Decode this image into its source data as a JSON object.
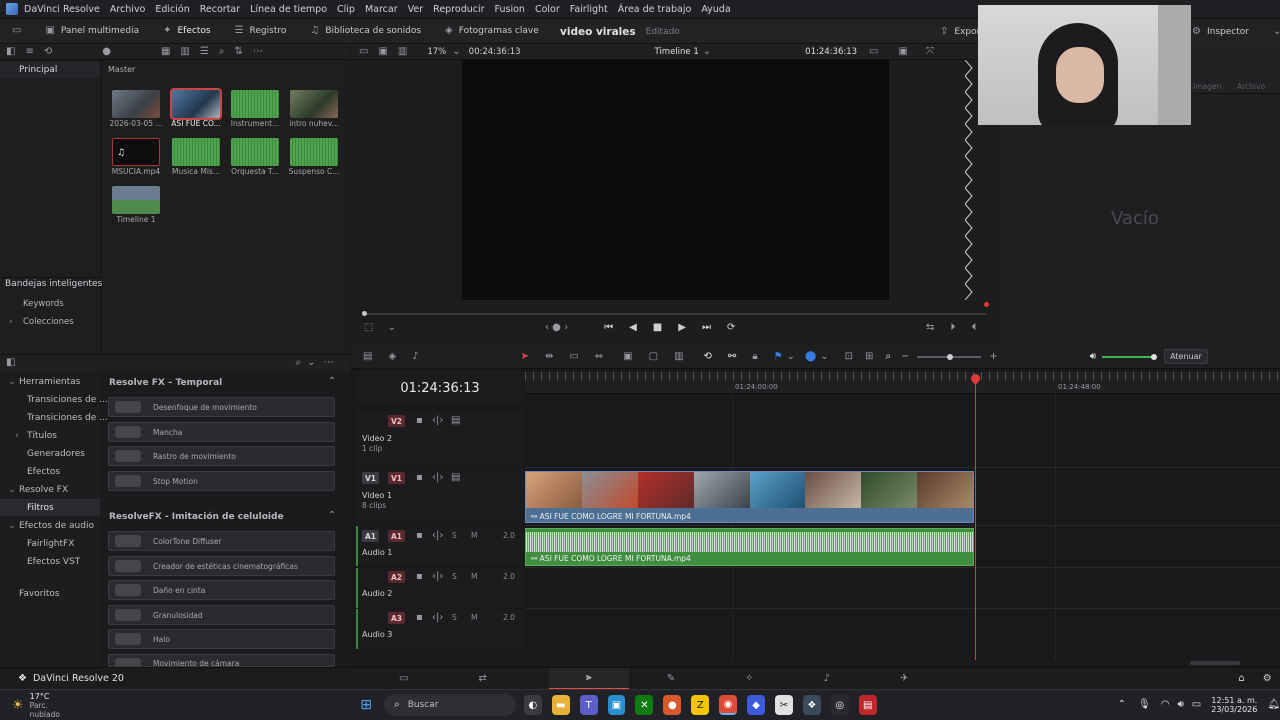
{
  "app": {
    "name": "DaVinci Resolve"
  },
  "menu": [
    "DaVinci Resolve",
    "Archivo",
    "Edición",
    "Recortar",
    "Línea de tiempo",
    "Clip",
    "Marcar",
    "Ver",
    "Reproducir",
    "Fusion",
    "Color",
    "Fairlight",
    "Área de trabajo",
    "Ayuda"
  ],
  "toolbar": {
    "media_pool": "Panel multimedia",
    "effects": "Efectos",
    "edit_index": "Registro",
    "sound_library": "Biblioteca de sonidos",
    "keyframes": "Fotogramas clave",
    "export": "Exporta",
    "inspector": "Inspector"
  },
  "project": {
    "title": "video virales",
    "state": "Editado"
  },
  "viewer": {
    "zoom": "17%",
    "source_tc": "00:24:36:13",
    "timeline_name": "Timeline 1",
    "record_tc": "01:24:36:13"
  },
  "media_pool": {
    "bin_principal": "Principal",
    "bin_master": "Master",
    "smart_bins": "Bandejas inteligentes",
    "smart_items": [
      "Keywords",
      "Colecciones"
    ],
    "clips": [
      {
        "label": "2026-03-05 ...",
        "kind": "video"
      },
      {
        "label": "ASI FUE CO...",
        "kind": "video"
      },
      {
        "label": "Instrument...",
        "kind": "audio"
      },
      {
        "label": "intro nuhev...",
        "kind": "video"
      },
      {
        "label": "MSUCIA.mp4",
        "kind": "audio-dark"
      },
      {
        "label": "Musica Mis...",
        "kind": "audio"
      },
      {
        "label": "Orquesta T...",
        "kind": "audio"
      },
      {
        "label": "Suspenso C...",
        "kind": "audio"
      },
      {
        "label": "Timeline 1",
        "kind": "timeline"
      }
    ]
  },
  "inspector": {
    "empty": "Vacío",
    "tab_image": "Imagen",
    "tab_file": "Archivo"
  },
  "fx_sidebar": {
    "items": [
      {
        "label": "Herramientas",
        "level": 0
      },
      {
        "label": "Transiciones de ...",
        "level": 1
      },
      {
        "label": "Transiciones de ...",
        "level": 1
      },
      {
        "label": "Títulos",
        "level": 1
      },
      {
        "label": "Generadores",
        "level": 1
      },
      {
        "label": "Efectos",
        "level": 1
      },
      {
        "label": "Resolve FX",
        "level": 0
      },
      {
        "label": "Filtros",
        "level": 1
      },
      {
        "label": "Efectos de audio",
        "level": 0
      },
      {
        "label": "FairlightFX",
        "level": 1
      },
      {
        "label": "Efectos VST",
        "level": 1
      },
      {
        "label": "Favoritos",
        "level": 0
      }
    ]
  },
  "fx_list": {
    "section1": "Resolve FX – Temporal",
    "section1_items": [
      "Desenfoque de movimiento",
      "Mancha",
      "Rastro de movimiento",
      "Stop Motion"
    ],
    "section2": "ResolveFX - Imitación de celuloide",
    "section2_items": [
      "ColorTone Diffuser",
      "Creador de estéticas cinematográficas",
      "Daño en cinta",
      "Granulosidad",
      "Halo",
      "Movimiento de cámara"
    ]
  },
  "timeline": {
    "timecode": "01:24:36:13",
    "ruler": [
      "01:24:00:00",
      "01:24:48:00"
    ],
    "mute_label": "Atenuar",
    "tracks": {
      "v2": {
        "tag": "V2",
        "name": "Video 2",
        "sub": "1 clip"
      },
      "v1": {
        "tag_src": "V1",
        "tag": "V1",
        "name": "Video 1",
        "sub": "8 clips"
      },
      "a1": {
        "tag_src": "A1",
        "tag": "A1",
        "name": "Audio 1",
        "level": "2.0",
        "s": "S",
        "m": "M"
      },
      "a2": {
        "tag": "A2",
        "name": "Audio 2",
        "level": "2.0",
        "s": "S",
        "m": "M"
      },
      "a3": {
        "tag": "A3",
        "name": "Audio 3",
        "level": "2.0",
        "s": "S",
        "m": "M"
      }
    },
    "video_clip": "ASI FUE COMO LOGRE MI FORTUNA.mp4",
    "audio_clip": "ASI FUE COMO LOGRE MI FORTUNA.mp4"
  },
  "footer": {
    "app_version": "DaVinci Resolve 20"
  },
  "taskbar": {
    "weather_temp": "17°C",
    "weather_desc": "Parc. nublado",
    "search": "Buscar",
    "time": "12:51 a. m.",
    "date": "23/03/2026"
  },
  "colors": {
    "accent": "#e24b4b",
    "video_clip": "#4d6f93",
    "audio_clip": "#3f8f3f",
    "playhead": "#e03a3a"
  }
}
